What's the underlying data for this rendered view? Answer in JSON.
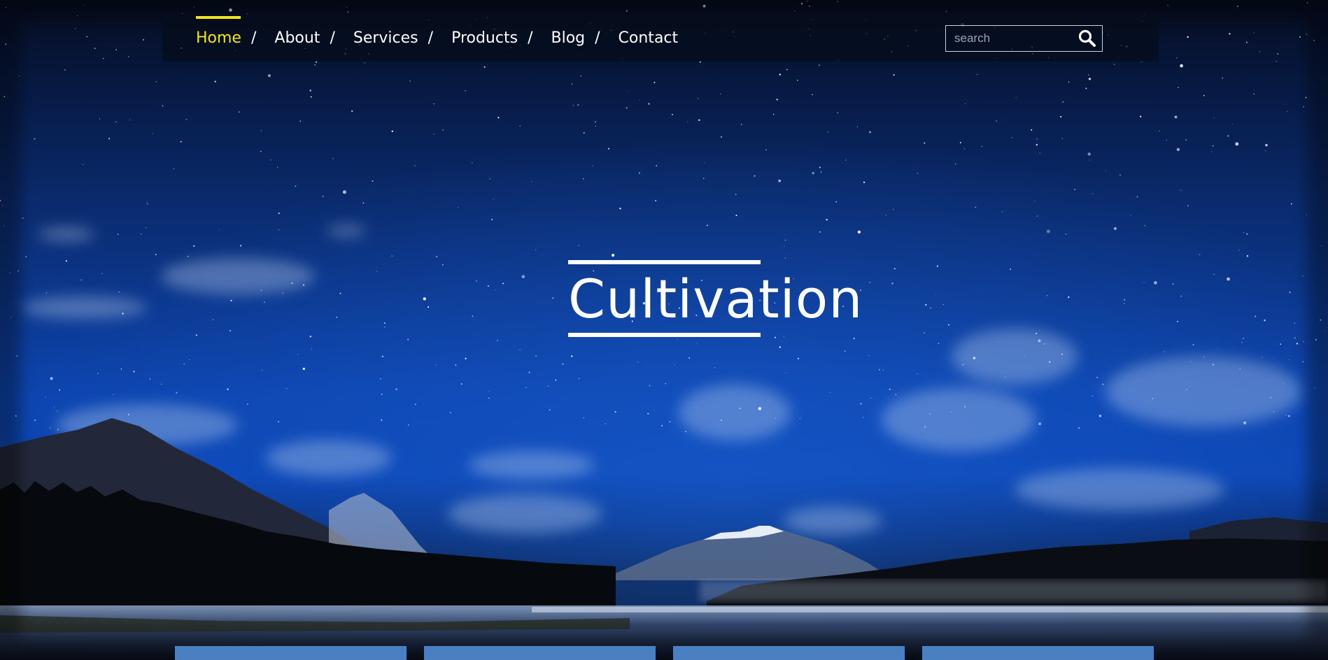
{
  "nav": {
    "items": [
      {
        "label": "Home",
        "active": true
      },
      {
        "label": "About",
        "active": false
      },
      {
        "label": "Services",
        "active": false
      },
      {
        "label": "Products",
        "active": false
      },
      {
        "label": "Blog",
        "active": false
      },
      {
        "label": "Contact",
        "active": false
      }
    ],
    "separator": "/",
    "active_color": "#f4e41a"
  },
  "search": {
    "placeholder": "search",
    "value": "",
    "button_icon": "search-icon"
  },
  "hero": {
    "title": "Cultivation"
  },
  "cards": {
    "count": 4,
    "color": "#4a7fc1"
  },
  "background": {
    "description_icon": "night-sky-mountain-lake-image"
  }
}
